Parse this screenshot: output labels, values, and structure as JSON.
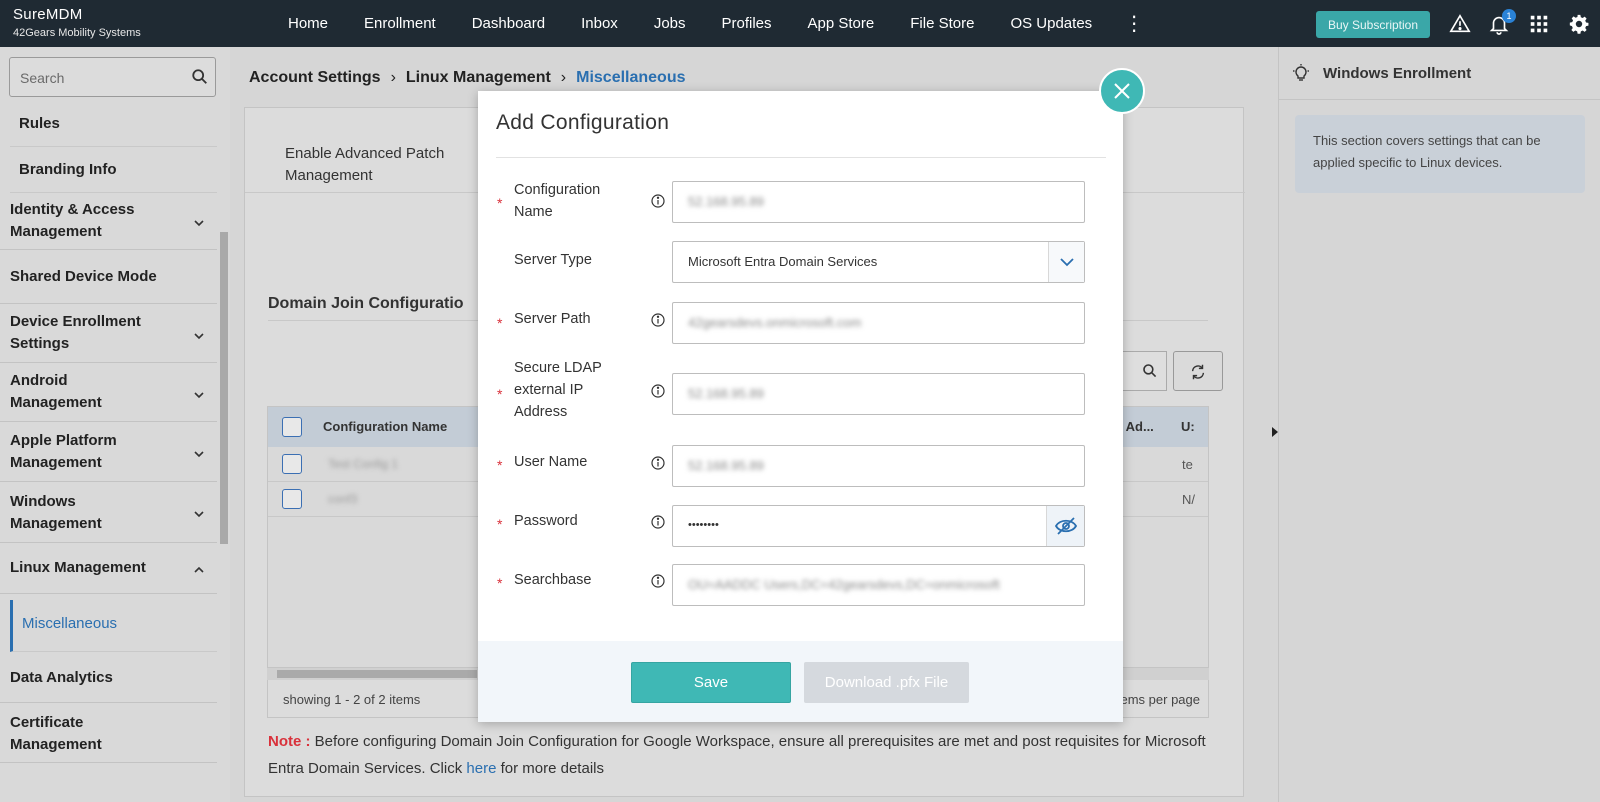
{
  "brand": {
    "name": "SureMDM",
    "company": "42Gears Mobility Systems"
  },
  "nav": {
    "items": [
      "Home",
      "Enrollment",
      "Dashboard",
      "Inbox",
      "Jobs",
      "Profiles",
      "App Store",
      "File Store",
      "OS Updates"
    ]
  },
  "topbar": {
    "buy_label": "Buy Subscription",
    "notification_count": "1"
  },
  "sidebar": {
    "search_placeholder": "Search",
    "sub_top": [
      "Rules",
      "Branding Info"
    ],
    "items": [
      "Identity & Access Management",
      "Shared Device Mode",
      "Device Enrollment Settings",
      "Android Management",
      "Apple Platform Management",
      "Windows Management",
      "Linux Management",
      "Miscellaneous",
      "Data Analytics",
      "Certificate Management"
    ]
  },
  "breadcrumb": {
    "level1": "Account Settings",
    "level2": "Linux Management",
    "level3": "Miscellaneous"
  },
  "main": {
    "advanced_patch": "Enable Advanced Patch Management",
    "domain_join_title": "Domain Join Configuratio",
    "table": {
      "col_config_name": "Configuration Name",
      "col_ip": "al IP Ad...",
      "col_user": "U:",
      "rows": [
        {
          "name": "Test Config 1",
          "user": "te"
        },
        {
          "name": "conf3",
          "user": "N/"
        }
      ]
    },
    "showing": "showing 1 - 2 of 2 items",
    "items_per_page": "items per page",
    "note_label": "Note :",
    "note_text": " Before configuring Domain Join Configuration for Google Workspace, ensure all prerequisites are met and post requisites for Microsoft Entra Domain Services. Click ",
    "note_link": "here",
    "note_tail": " for more details"
  },
  "right_panel": {
    "title": "Windows Enrollment",
    "desc": "This section covers settings that can be applied specific to Linux devices."
  },
  "modal": {
    "title": "Add Configuration",
    "fields": {
      "config_name": {
        "label": "Configuration Name",
        "value": "52.168.95.89"
      },
      "server_type": {
        "label": "Server Type",
        "value": "Microsoft Entra Domain Services"
      },
      "server_path": {
        "label": "Server Path",
        "value": "42gearsdevs.onmicrosoft.com"
      },
      "ldap_ip": {
        "label": "Secure LDAP external IP Address",
        "value": "52.168.95.89"
      },
      "user_name": {
        "label": "User Name",
        "value": "52.168.95.89"
      },
      "password": {
        "label": "Password",
        "value": "••••••••"
      },
      "searchbase": {
        "label": "Searchbase",
        "value": "OU=AADDC Users,DC=42gearsdevs,DC=onmicrosoft"
      }
    },
    "save_label": "Save",
    "download_label": "Download .pfx File"
  },
  "colors": {
    "accent": "#3fb8b5",
    "topbar": "#1f2a33",
    "link": "#2a6fb0",
    "required": "#d9313b"
  }
}
